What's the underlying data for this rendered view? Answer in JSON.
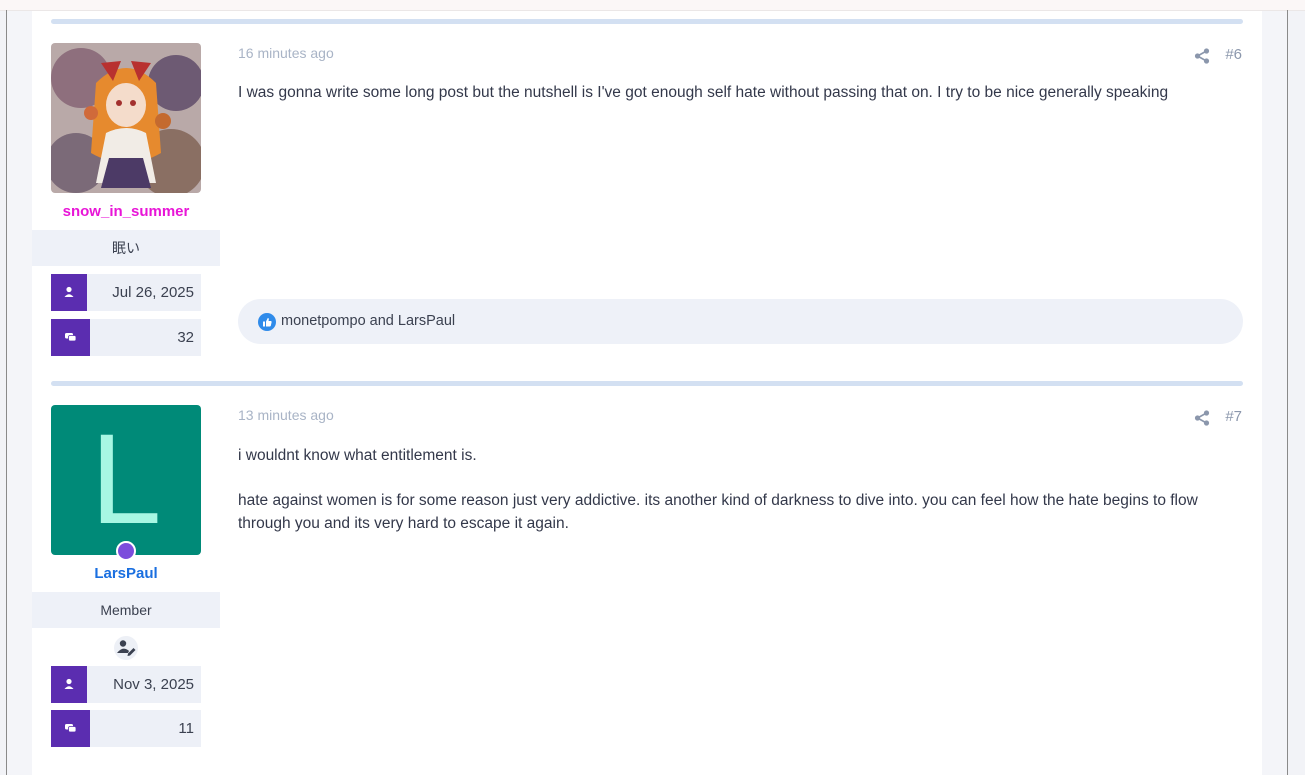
{
  "posts": [
    {
      "username": "snow_in_summer",
      "username_color": "#e815d7",
      "user_title": "眠い",
      "avatar_type": "illustration",
      "joined": "Jul 26, 2025",
      "messages": "32",
      "time_ago": "16 minutes ago",
      "post_number": "#6",
      "paragraphs": [
        "I was gonna write some long post but the nutshell is I've got enough self hate without passing that on. I try to be nice generally speaking"
      ],
      "reactions_text": "monetpompo and LarsPaul",
      "reaction_icon": "like-icon"
    },
    {
      "username": "LarsPaul",
      "username_color": "#1a6fe0",
      "user_title": "Member",
      "avatar_type": "letter",
      "avatar_letter": "L",
      "avatar_bg": "#008a78",
      "avatar_fg": "#a7f7e3",
      "online": true,
      "badge_icon": "user-edit-icon",
      "joined": "Nov 3, 2025",
      "messages": "11",
      "time_ago": "13 minutes ago",
      "post_number": "#7",
      "paragraphs": [
        "i wouldnt know what entitlement is.",
        "hate against women is for some reason just very addictive. its another kind of darkness to dive into. you can feel how the hate begins to flow through you and its very hard to escape it again."
      ]
    }
  ],
  "colors": {
    "stat_icon_bg": "#5b2db0",
    "separator": "#d3e0f2",
    "online_dot": "#7c4ddc"
  }
}
